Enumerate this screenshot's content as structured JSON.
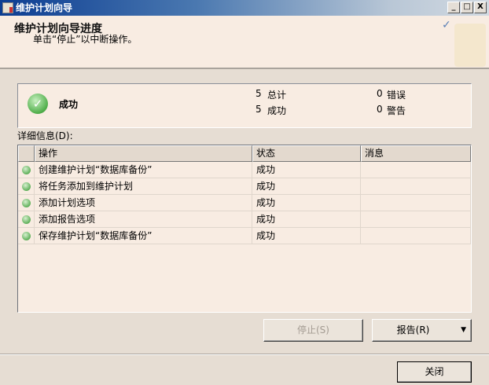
{
  "window": {
    "title": "维护计划向导",
    "min": "_",
    "max": "□",
    "close": "X"
  },
  "header": {
    "title": "维护计划向导进度",
    "subtitle": "单击“停止”以中断操作。"
  },
  "summary": {
    "status": "成功",
    "total_count": "5",
    "total_label": "总计",
    "success_count": "5",
    "success_label": "成功",
    "error_count": "0",
    "error_label": "错误",
    "warning_count": "0",
    "warning_label": "警告"
  },
  "details": {
    "label": "详细信息(D):",
    "columns": [
      "操作",
      "状态",
      "消息"
    ],
    "rows": [
      {
        "action": "创建维护计划“数据库备份”",
        "status": "成功",
        "message": ""
      },
      {
        "action": "将任务添加到维护计划",
        "status": "成功",
        "message": ""
      },
      {
        "action": "添加计划选项",
        "status": "成功",
        "message": ""
      },
      {
        "action": "添加报告选项",
        "status": "成功",
        "message": ""
      },
      {
        "action": "保存维护计划“数据库备份”",
        "status": "成功",
        "message": ""
      }
    ]
  },
  "buttons": {
    "stop": "停止(S)",
    "report": "报告(R)",
    "report_arrow": "▼",
    "close": "关闭"
  }
}
